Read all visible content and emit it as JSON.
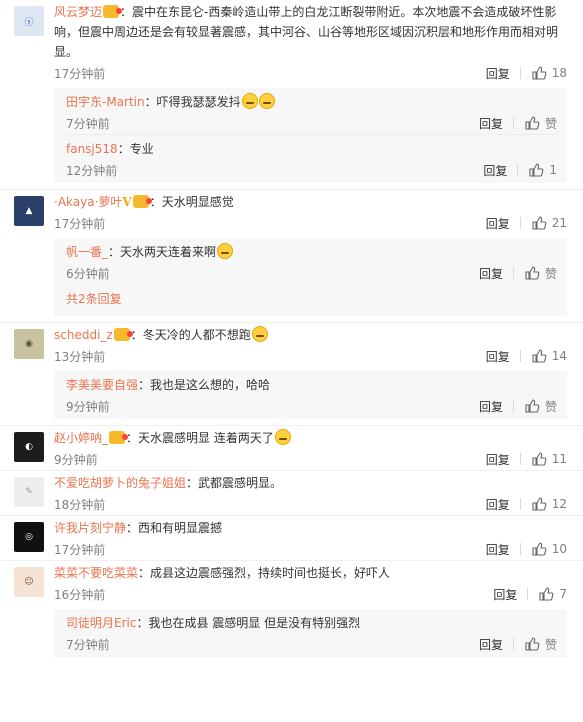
{
  "actions": {
    "reply": "回复",
    "like": "赞"
  },
  "comments": [
    {
      "user": "风云梦迈",
      "text": "：震中在东昆仑-西秦岭造山带上的白龙江断裂带附近。本次地震不会造成破坏性影响，但震中周边还是会有较显著震感，其中河谷、山谷等地形区域因沉积层和地形作用而相对明显。",
      "time": "17分钟前",
      "likes": "18",
      "replies": [
        {
          "user": "田宇东-Martin",
          "text": "：吓得我瑟瑟发抖",
          "time": "7分钟前"
        },
        {
          "user": "fansj518",
          "text": "：专业",
          "time": "12分钟前",
          "likes": "1"
        }
      ]
    },
    {
      "user": "·Akaya·萝叶",
      "text": "：天水明显感觉",
      "time": "17分钟前",
      "likes": "21",
      "replies": [
        {
          "user": "帆一番_",
          "text": "：天水两天连着来啊",
          "time": "6分钟前"
        }
      ],
      "more": "共2条回复"
    },
    {
      "user": "scheddi_z",
      "text": "：冬天冷的人都不想跑",
      "time": "13分钟前",
      "likes": "14",
      "replies": [
        {
          "user": "李美美要自强",
          "text": "：我也是这么想的，哈哈",
          "time": "9分钟前"
        }
      ]
    },
    {
      "user": "赵小婷呐_",
      "text": "：天水震感明显 连着两天了",
      "time": "9分钟前",
      "likes": "11"
    },
    {
      "user": "不爱吃胡萝卜的兔子姐姐",
      "text": "：武都震感明显。",
      "time": "18分钟前",
      "likes": "12"
    },
    {
      "user": "许我片刻宁静",
      "text": "：西和有明显震撼",
      "time": "17分钟前",
      "likes": "10"
    },
    {
      "user": "菜菜不要吃菜菜",
      "text": "：成县这边震感强烈，持续时间也挺长，好吓人",
      "time": "16分钟前",
      "likes": "7",
      "replies": [
        {
          "user": "司徒明月Eric",
          "text": "：我也在成县 震感明显 但是没有特别强烈",
          "time": "7分钟前"
        }
      ]
    }
  ]
}
